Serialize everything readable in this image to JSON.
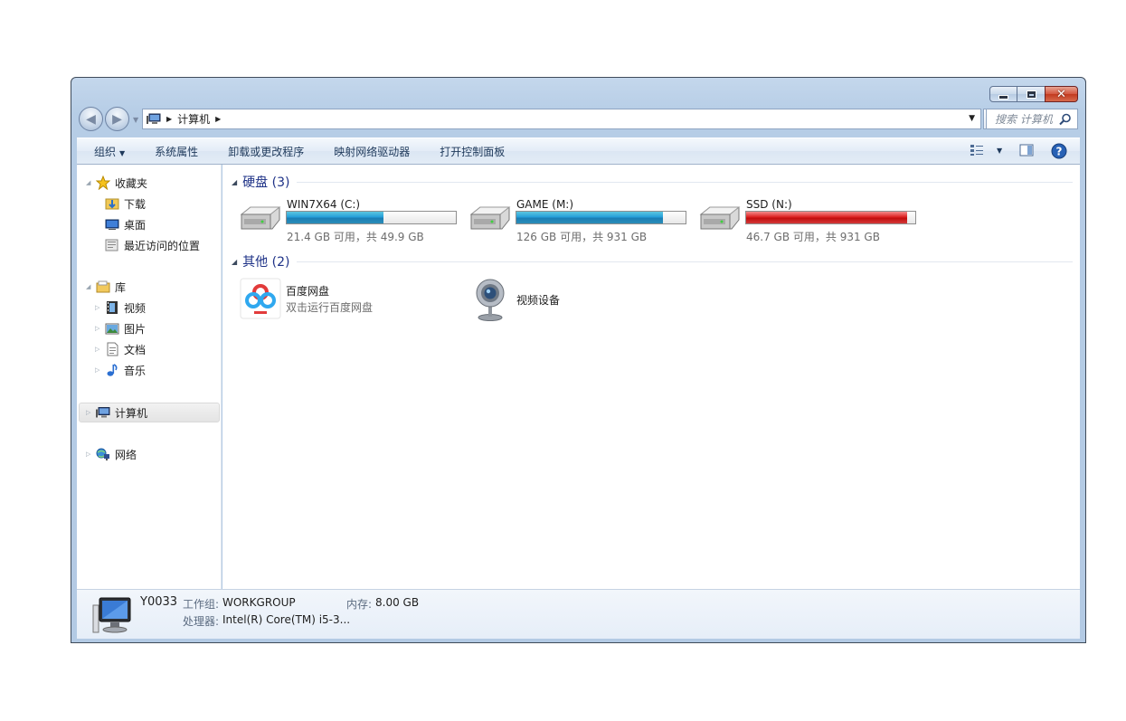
{
  "window": {
    "caption_buttons": [
      "minimize",
      "maximize",
      "close"
    ]
  },
  "address_bar": {
    "crumb": "计算机",
    "search_placeholder": "搜索 计算机"
  },
  "toolbar": {
    "organize": "组织",
    "system_properties": "系统属性",
    "uninstall": "卸载或更改程序",
    "map_drive": "映射网络驱动器",
    "control_panel": "打开控制面板"
  },
  "nav": {
    "favorites": "收藏夹",
    "downloads": "下载",
    "desktop": "桌面",
    "recent": "最近访问的位置",
    "libraries": "库",
    "videos": "视频",
    "pictures": "图片",
    "documents": "文档",
    "music": "音乐",
    "computer": "计算机",
    "network": "网络"
  },
  "groups": {
    "hard_drives": "硬盘 (3)",
    "other": "其他 (2)"
  },
  "drives": [
    {
      "name": "WIN7X64 (C:)",
      "info": "21.4 GB 可用，共 49.9 GB",
      "used_fraction": 0.57,
      "status": "normal"
    },
    {
      "name": "GAME (M:)",
      "info": "126 GB 可用，共 931 GB",
      "used_fraction": 0.865,
      "status": "normal"
    },
    {
      "name": "SSD (N:)",
      "info": "46.7 GB 可用，共 931 GB",
      "used_fraction": 0.95,
      "status": "critical"
    }
  ],
  "others": [
    {
      "name": "百度网盘",
      "desc": "双击运行百度网盘"
    },
    {
      "name": "视频设备"
    }
  ],
  "details": {
    "computer_name": "Y0033",
    "workgroup_label": "工作组:",
    "workgroup": "WORKGROUP",
    "memory_label": "内存:",
    "memory": "8.00 GB",
    "processor_label": "处理器:",
    "processor": "Intel(R) Core(TM) i5-3..."
  }
}
